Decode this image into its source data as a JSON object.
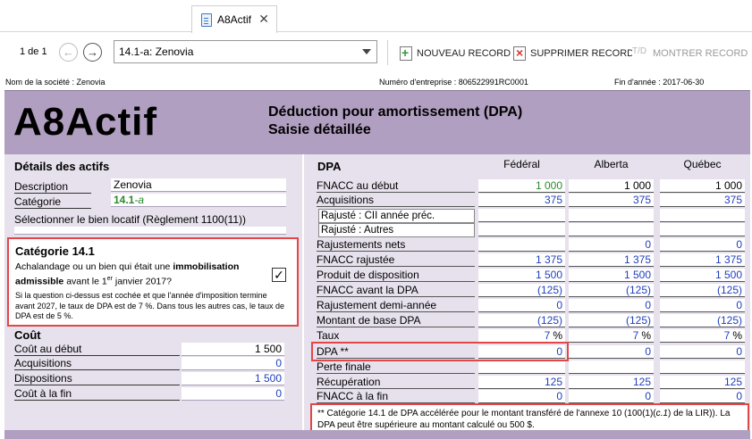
{
  "tab": {
    "title": "A8Actif",
    "close": "✕"
  },
  "toolbar": {
    "pager": "1 de 1",
    "prev": "←",
    "next": "→",
    "record_value": "14.1-a: Zenovia",
    "new_label": "NOUVEAU RECORD",
    "delete_label": "SUPPRIMER RECORD",
    "show_label": "MONTRER RECORD",
    "show_icon_text": "T/D"
  },
  "info": {
    "company": "Nom de la société : Zenovia",
    "business_number": "Numéro d'entreprise : 806522991RC0001",
    "year_end": "Fin d'année : 2017-06-30"
  },
  "header": {
    "form": "A8Actif",
    "title1": "Déduction pour amortissement (DPA)",
    "title2": "Saisie détaillée"
  },
  "details": {
    "title": "Détails des actifs",
    "description_label": "Description",
    "description_value": "Zenovia",
    "category_label": "Catégorie",
    "category_value": "14.1",
    "category_suffix": "-a",
    "rental_label": "Sélectionner le bien locatif (Règlement 1100(11))"
  },
  "cat141": {
    "title": "Catégorie 14.1",
    "q_part1": "Achalandage ou un bien qui était une ",
    "q_bold1": "immobilisation",
    "q_bold2": "admissible",
    "q_part2": " avant le 1",
    "q_sup": "er",
    "q_part3": " janvier 2017?",
    "checked": "✓",
    "note": "Si la question ci-dessus est cochée et que l'année d'imposition termine avant 2027, le taux de DPA est de 7 %. Dans tous les autres cas, le taux de DPA est de 5 %."
  },
  "cost": {
    "title": "Coût",
    "rows": [
      {
        "label": "Coût au début",
        "value": "1 500",
        "color": "black"
      },
      {
        "label": "Acquisitions",
        "value": "0",
        "color": "blue"
      },
      {
        "label": "Dispositions",
        "value": "1 500",
        "color": "blue"
      },
      {
        "label": "Coût à la fin",
        "value": "0",
        "color": "blue"
      }
    ]
  },
  "dpa": {
    "title": "DPA",
    "col_federal": "Fédéral",
    "col_alberta": "Alberta",
    "col_quebec": "Québec",
    "rows": [
      {
        "label": "FNACC au début",
        "f": "1 000",
        "a": "1 000",
        "q": "1 000"
      },
      {
        "label": "Acquisitions",
        "f": "375",
        "a": "375",
        "q": "375"
      },
      {
        "label": "Rajusté : CII année préc.",
        "f": "",
        "a": "",
        "q": ""
      },
      {
        "label": "Rajusté : Autres",
        "f": "",
        "a": "",
        "q": ""
      },
      {
        "label": "Rajustements nets",
        "f": "",
        "a": "0",
        "q": "0"
      },
      {
        "label": "FNACC rajustée",
        "f": "1 375",
        "a": "1 375",
        "q": "1 375"
      },
      {
        "label": "Produit de disposition",
        "f": "1 500",
        "a": "1 500",
        "q": "1 500"
      },
      {
        "label": "FNACC avant la DPA",
        "f": "(125)",
        "a": "(125)",
        "q": "(125)"
      },
      {
        "label": "Rajustement demi-année",
        "f": "0",
        "a": "0",
        "q": "0"
      },
      {
        "label": "Montant de base DPA",
        "f": "(125)",
        "a": "(125)",
        "q": "(125)"
      },
      {
        "label": "Taux",
        "f": "7",
        "a": "7",
        "q": "7",
        "unit": "%"
      },
      {
        "label": "DPA **",
        "f": "0",
        "a": "0",
        "q": "0"
      },
      {
        "label": "Perte finale",
        "f": "",
        "a": "",
        "q": ""
      },
      {
        "label": "Récupération",
        "f": "125",
        "a": "125",
        "q": "125"
      },
      {
        "label": "FNACC à la fin",
        "f": "0",
        "a": "0",
        "q": "0"
      }
    ],
    "footnote_a": "** Catégorie 14.1 de DPA accélérée pour le montant transféré de l'annexe 10 (100(1)(",
    "footnote_i": "c.1",
    "footnote_b": ") de la LIR)). La DPA peut être supérieure au montant calculé ou 500 $."
  },
  "colors": {
    "banner": "#b09fc0",
    "panel": "#e6e1ec",
    "highlight": "#e34646",
    "value_blue": "#1f3fbf",
    "value_green": "#2b8a2b"
  }
}
